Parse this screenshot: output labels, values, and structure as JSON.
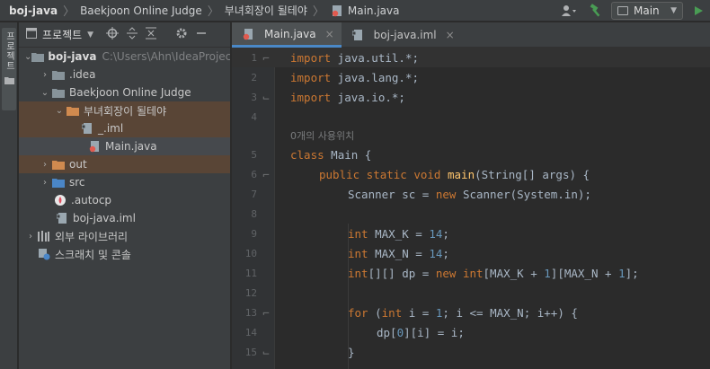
{
  "navbar": {
    "crumbs": [
      "boj-java",
      "Baekjoon Online Judge",
      "부녀회장이 될테야",
      "Main.java"
    ],
    "run_config": "Main"
  },
  "toolstrip": {
    "project_tab": "프로젝트"
  },
  "project": {
    "title": "프로젝트",
    "rows": [
      {
        "label": "boj-java",
        "hint": "C:\\Users\\Ahn\\IdeaProjec"
      },
      {
        "label": ".idea"
      },
      {
        "label": "Baekjoon Online Judge"
      },
      {
        "label": "부녀회장이 될테야"
      },
      {
        "label": "_.iml"
      },
      {
        "label": "Main.java"
      },
      {
        "label": "out"
      },
      {
        "label": "src"
      },
      {
        "label": ".autocp"
      },
      {
        "label": "boj-java.iml"
      },
      {
        "label": "외부 라이브러리"
      },
      {
        "label": "스크래치 및 콘솔"
      }
    ]
  },
  "editor": {
    "tabs": [
      {
        "label": "Main.java",
        "close": "×"
      },
      {
        "label": "boj-java.iml",
        "close": "×"
      }
    ],
    "usage_hint": "0개의 사용위치",
    "line_numbers": [
      "1",
      "2",
      "3",
      "4",
      "5",
      "6",
      "7",
      "8",
      "9",
      "10",
      "11",
      "12",
      "13",
      "14",
      "15"
    ],
    "code": {
      "l1": {
        "kw": "import",
        "rest": " java.util.*;"
      },
      "l2": {
        "kw": "import",
        "rest": " java.lang.*;"
      },
      "l3": {
        "kw": "import",
        "rest": " java.io.*;"
      },
      "l5": {
        "kw": "class",
        "rest": " Main {"
      },
      "l6": {
        "kw": "public static void",
        "fn": "main",
        "rest": "(String[] args) {"
      },
      "l7": {
        "pre": "Scanner sc = ",
        "kw": "new",
        "rest": " Scanner(System.in);"
      },
      "l9": {
        "kw": "int",
        "pre": " MAX_K = ",
        "num": "14",
        "rest": ";"
      },
      "l10": {
        "kw": "int",
        "pre": " MAX_N = ",
        "num": "14",
        "rest": ";"
      },
      "l11": {
        "kw1": "int",
        "a": "[][] dp = ",
        "kw2": "new",
        "b": " ",
        "kw3": "int",
        "c": "[MAX_K + ",
        "n1": "1",
        "d": "][MAX_N + ",
        "n2": "1",
        "e": "];"
      },
      "l13": {
        "kw1": "for",
        "a": " (",
        "kw2": "int",
        "b": " i = ",
        "n1": "1",
        "c": "; i <= MAX_N; i++) {"
      },
      "l14": {
        "a": "dp[",
        "n1": "0",
        "b": "][i] = i;"
      },
      "l15": {
        "a": "}"
      }
    }
  }
}
